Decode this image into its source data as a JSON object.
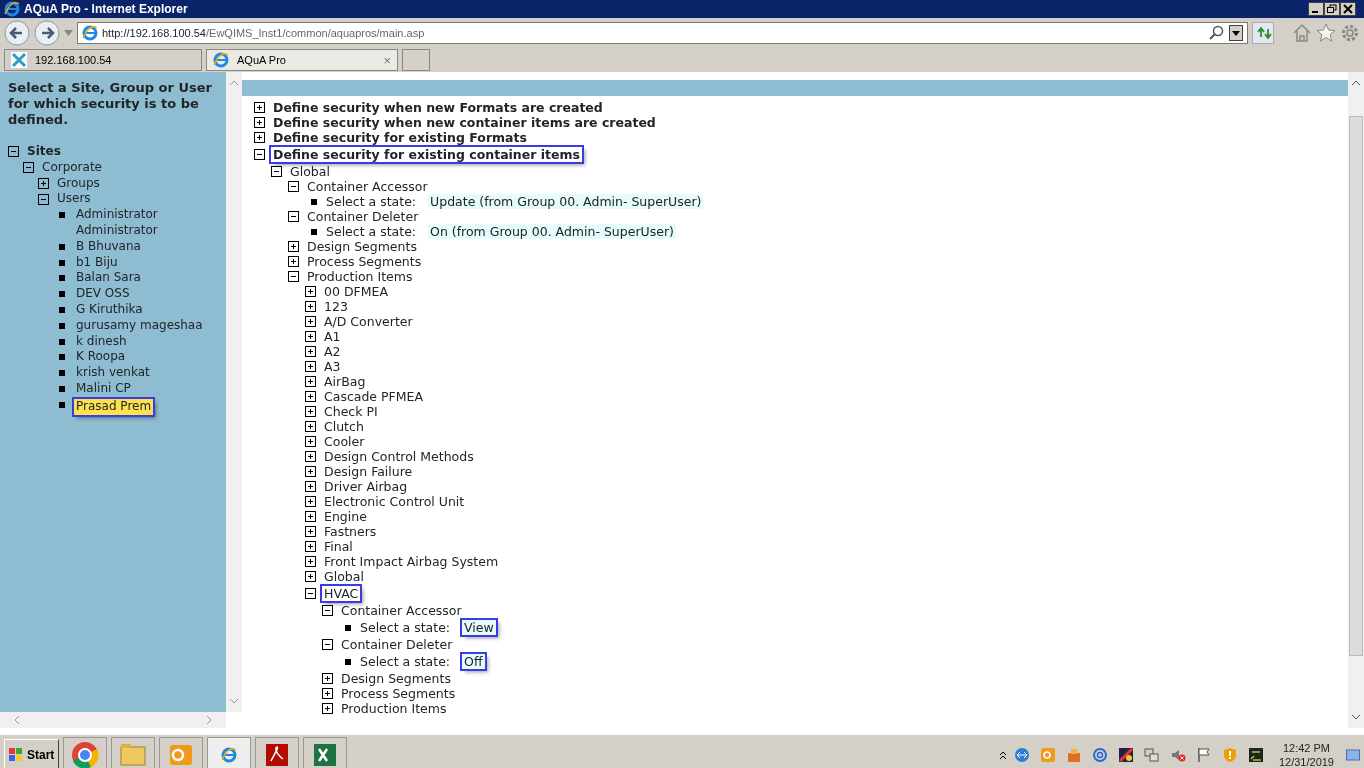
{
  "window": {
    "title": "AQuA Pro - Internet Explorer"
  },
  "address_bar": {
    "url_host": "http://192.168.100.54",
    "url_path": "/EwQIMS_Inst1/common/aquapros/main.asp"
  },
  "tabs": [
    {
      "label": "192.168.100.54",
      "selected": false,
      "kind": "app"
    },
    {
      "label": "AQuA Pro",
      "selected": true,
      "kind": "ie",
      "close": "×"
    }
  ],
  "sidebar": {
    "heading": "Select a Site, Group or User for which security is to be defined.",
    "tree": [
      {
        "kind": "node",
        "label": "Sites",
        "expanded": true,
        "children": [
          {
            "kind": "node",
            "label": "Corporate",
            "expanded": true,
            "children": [
              {
                "kind": "node",
                "label": "Groups",
                "expanded": false
              },
              {
                "kind": "node",
                "label": "Users",
                "expanded": true,
                "children": [
                  {
                    "kind": "leaf",
                    "label": "Administrator Administrator",
                    "selected": false
                  },
                  {
                    "kind": "leaf",
                    "label": "B Bhuvana",
                    "selected": false
                  },
                  {
                    "kind": "leaf",
                    "label": "b1 Biju",
                    "selected": false
                  },
                  {
                    "kind": "leaf",
                    "label": "Balan Sara",
                    "selected": false
                  },
                  {
                    "kind": "leaf",
                    "label": "DEV OSS",
                    "selected": false
                  },
                  {
                    "kind": "leaf",
                    "label": "G Kiruthika",
                    "selected": false
                  },
                  {
                    "kind": "leaf",
                    "label": "gurusamy mageshaa",
                    "selected": false
                  },
                  {
                    "kind": "leaf",
                    "label": "k dinesh",
                    "selected": false
                  },
                  {
                    "kind": "leaf",
                    "label": "K Roopa",
                    "selected": false
                  },
                  {
                    "kind": "leaf",
                    "label": "krish venkat",
                    "selected": false
                  },
                  {
                    "kind": "leaf",
                    "label": "Malini CP",
                    "selected": false
                  },
                  {
                    "kind": "leaf",
                    "label": "Prasad Prem",
                    "selected": true,
                    "outlined": true
                  }
                ]
              }
            ]
          }
        ]
      }
    ]
  },
  "main_tree": [
    {
      "kind": "node",
      "label": "Define security when new Formats are created",
      "expanded": false
    },
    {
      "kind": "node",
      "label": "Define security when new container items are created",
      "expanded": false
    },
    {
      "kind": "node",
      "label": "Define security for existing Formats",
      "expanded": false
    },
    {
      "kind": "node",
      "label": "Define security for existing container items",
      "expanded": true,
      "outlined": true,
      "children": [
        {
          "kind": "node",
          "label": "Global",
          "expanded": true,
          "children": [
            {
              "kind": "node",
              "label": "Container Accessor",
              "expanded": true,
              "children": [
                {
                  "kind": "state",
                  "label": "Select a state:",
                  "value": "Update (from Group 00. Admin- SuperUser)"
                }
              ]
            },
            {
              "kind": "node",
              "label": "Container Deleter",
              "expanded": true,
              "children": [
                {
                  "kind": "state",
                  "label": "Select a state:",
                  "value": "On (from Group 00. Admin- SuperUser)"
                }
              ]
            },
            {
              "kind": "node",
              "label": "Design Segments",
              "expanded": false
            },
            {
              "kind": "node",
              "label": "Process Segments",
              "expanded": false
            },
            {
              "kind": "node",
              "label": "Production Items",
              "expanded": true,
              "children": [
                {
                  "kind": "node",
                  "label": "00 DFMEA",
                  "expanded": false
                },
                {
                  "kind": "node",
                  "label": "123",
                  "expanded": false
                },
                {
                  "kind": "node",
                  "label": "A/D Converter",
                  "expanded": false
                },
                {
                  "kind": "node",
                  "label": "A1",
                  "expanded": false
                },
                {
                  "kind": "node",
                  "label": "A2",
                  "expanded": false
                },
                {
                  "kind": "node",
                  "label": "A3",
                  "expanded": false
                },
                {
                  "kind": "node",
                  "label": "AirBag",
                  "expanded": false
                },
                {
                  "kind": "node",
                  "label": "Cascade PFMEA",
                  "expanded": false
                },
                {
                  "kind": "node",
                  "label": "Check PI",
                  "expanded": false
                },
                {
                  "kind": "node",
                  "label": "Clutch",
                  "expanded": false
                },
                {
                  "kind": "node",
                  "label": "Cooler",
                  "expanded": false
                },
                {
                  "kind": "node",
                  "label": "Design Control Methods",
                  "expanded": false
                },
                {
                  "kind": "node",
                  "label": "Design Failure",
                  "expanded": false
                },
                {
                  "kind": "node",
                  "label": "Driver Airbag",
                  "expanded": false
                },
                {
                  "kind": "node",
                  "label": "Electronic Control Unit",
                  "expanded": false
                },
                {
                  "kind": "node",
                  "label": "Engine",
                  "expanded": false
                },
                {
                  "kind": "node",
                  "label": "Fastners",
                  "expanded": false
                },
                {
                  "kind": "node",
                  "label": "Final",
                  "expanded": false
                },
                {
                  "kind": "node",
                  "label": "Front Impact Airbag System",
                  "expanded": false
                },
                {
                  "kind": "node",
                  "label": "Global",
                  "expanded": false
                },
                {
                  "kind": "node",
                  "label": "HVAC",
                  "expanded": true,
                  "outlined": true,
                  "children": [
                    {
                      "kind": "node",
                      "label": "Container Accessor",
                      "expanded": true,
                      "children": [
                        {
                          "kind": "state",
                          "label": "Select a state:",
                          "value": "View",
                          "outlined": true
                        }
                      ]
                    },
                    {
                      "kind": "node",
                      "label": "Container Deleter",
                      "expanded": true,
                      "children": [
                        {
                          "kind": "state",
                          "label": "Select a state:",
                          "value": "Off",
                          "outlined": true
                        }
                      ]
                    },
                    {
                      "kind": "node",
                      "label": "Design Segments",
                      "expanded": false
                    },
                    {
                      "kind": "node",
                      "label": "Process Segments",
                      "expanded": false
                    },
                    {
                      "kind": "node",
                      "label": "Production Items",
                      "expanded": false
                    }
                  ]
                }
              ]
            }
          ]
        }
      ]
    }
  ],
  "taskbar": {
    "start": "Start",
    "time": "12:42 PM",
    "date": "12/31/2019"
  }
}
